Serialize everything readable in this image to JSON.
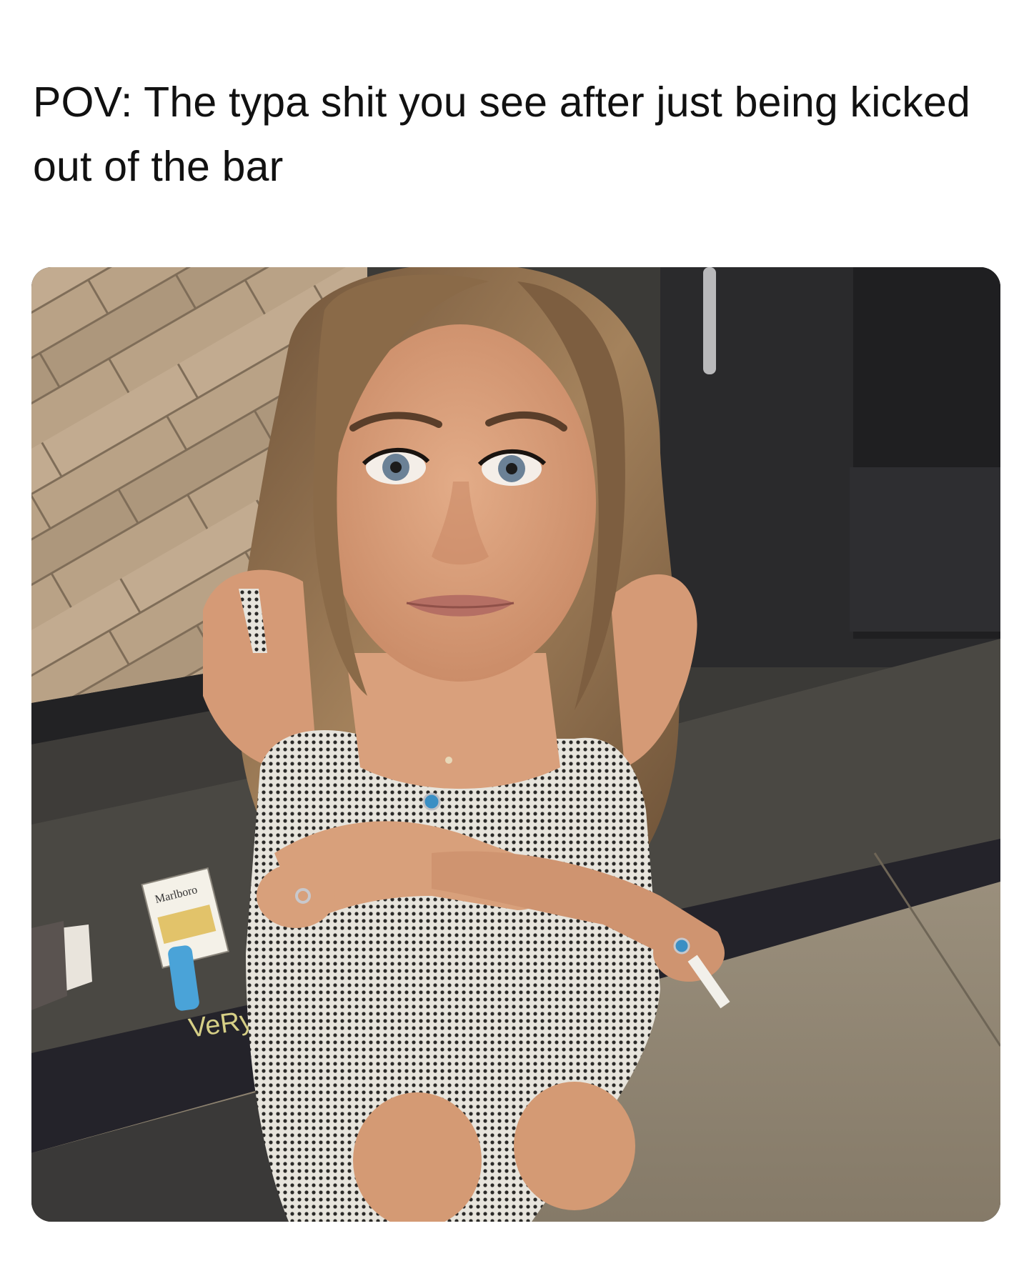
{
  "post": {
    "caption": "POV: The typa shit you see after just being kicked out of the bar"
  },
  "photo": {
    "cigarette_pack_text": "Marlboro",
    "chalk_text": "VeRy"
  },
  "colors": {
    "background": "#ffffff",
    "caption_text": "#111111",
    "wood_floor": "#b9a286",
    "dark_wall": "#2a2a2c",
    "step_concrete": "#4a4843",
    "sidewalk": "#8f8573",
    "hair": "#8a6a48",
    "skin": "#d9a07c",
    "lighter_blue": "#4aa3d8"
  }
}
